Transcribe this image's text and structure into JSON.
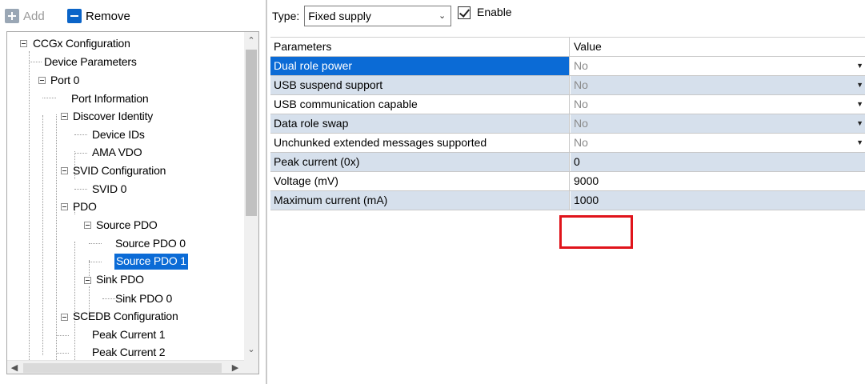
{
  "toolbar": {
    "add_label": "Add",
    "remove_label": "Remove"
  },
  "tree": {
    "nodes": [
      {
        "label": "CCGx Configuration"
      },
      {
        "label": "Device Parameters"
      },
      {
        "label": "Port 0"
      },
      {
        "label": "Port Information"
      },
      {
        "label": "Discover Identity"
      },
      {
        "label": "Device IDs"
      },
      {
        "label": "AMA VDO"
      },
      {
        "label": "SVID Configuration"
      },
      {
        "label": "SVID 0"
      },
      {
        "label": "PDO"
      },
      {
        "label": "Source PDO"
      },
      {
        "label": "Source PDO 0"
      },
      {
        "label": "Source PDO 1",
        "selected": true
      },
      {
        "label": "Sink PDO"
      },
      {
        "label": "Sink PDO 0"
      },
      {
        "label": "SCEDB Configuration"
      },
      {
        "label": "Peak Current 1"
      },
      {
        "label": "Peak Current 2"
      }
    ]
  },
  "right": {
    "type_label": "Type:",
    "type_value": "Fixed supply",
    "enable_label": "Enable",
    "enable_checked": true
  },
  "grid": {
    "headers": [
      "Parameters",
      "Value"
    ],
    "rows": [
      {
        "param": "Dual role power",
        "value": "No",
        "dropdown": true
      },
      {
        "param": "USB suspend support",
        "value": "No",
        "dropdown": true
      },
      {
        "param": "USB communication capable",
        "value": "No",
        "dropdown": true
      },
      {
        "param": "Data role swap",
        "value": "No",
        "dropdown": true
      },
      {
        "param": "Unchunked extended messages supported",
        "value": "No",
        "dropdown": true
      },
      {
        "param": "Peak current (0x)",
        "value": "0"
      },
      {
        "param": "Voltage (mV)",
        "value": "9000"
      },
      {
        "param": "Maximum current (mA)",
        "value": "1000",
        "highlighted": true
      }
    ]
  },
  "colors": {
    "selection": "#0b6bd6",
    "row_alt": "#d6e0ec",
    "highlight": "#e0141b"
  }
}
